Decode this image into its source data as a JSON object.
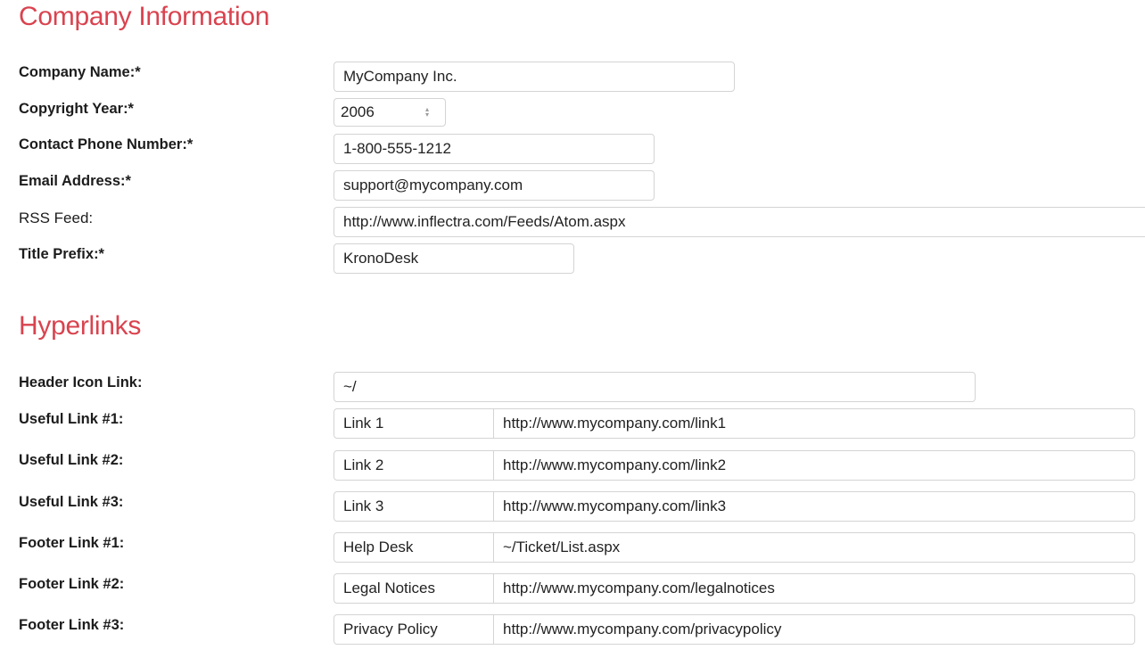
{
  "company": {
    "heading": "Company Information",
    "company_name": {
      "label": "Company Name:*",
      "value": "MyCompany Inc."
    },
    "copyright_year": {
      "label": "Copyright Year:*",
      "value": "2006"
    },
    "contact_phone": {
      "label": "Contact Phone Number:*",
      "value": "1-800-555-1212"
    },
    "email": {
      "label": "Email Address:*",
      "value": "support@mycompany.com"
    },
    "rss_feed": {
      "label": "RSS Feed:",
      "value": "http://www.inflectra.com/Feeds/Atom.aspx"
    },
    "title_prefix": {
      "label": "Title Prefix:*",
      "value": "KronoDesk"
    }
  },
  "hyperlinks": {
    "heading": "Hyperlinks",
    "header_icon_link": {
      "label": "Header Icon Link:",
      "value": "~/"
    },
    "links": [
      {
        "label": "Useful Link #1:",
        "text": "Link 1",
        "url": "http://www.mycompany.com/link1"
      },
      {
        "label": "Useful Link #2:",
        "text": "Link 2",
        "url": "http://www.mycompany.com/link2"
      },
      {
        "label": "Useful Link #3:",
        "text": "Link 3",
        "url": "http://www.mycompany.com/link3"
      },
      {
        "label": "Footer Link #1:",
        "text": "Help Desk",
        "url": "~/Ticket/List.aspx"
      },
      {
        "label": "Footer Link #2:",
        "text": "Legal Notices",
        "url": "http://www.mycompany.com/legalnotices"
      },
      {
        "label": "Footer Link #3:",
        "text": "Privacy Policy",
        "url": "http://www.mycompany.com/privacypolicy"
      }
    ]
  },
  "colors": {
    "heading": "#d9434f",
    "field_border": "#d4d4d4"
  }
}
